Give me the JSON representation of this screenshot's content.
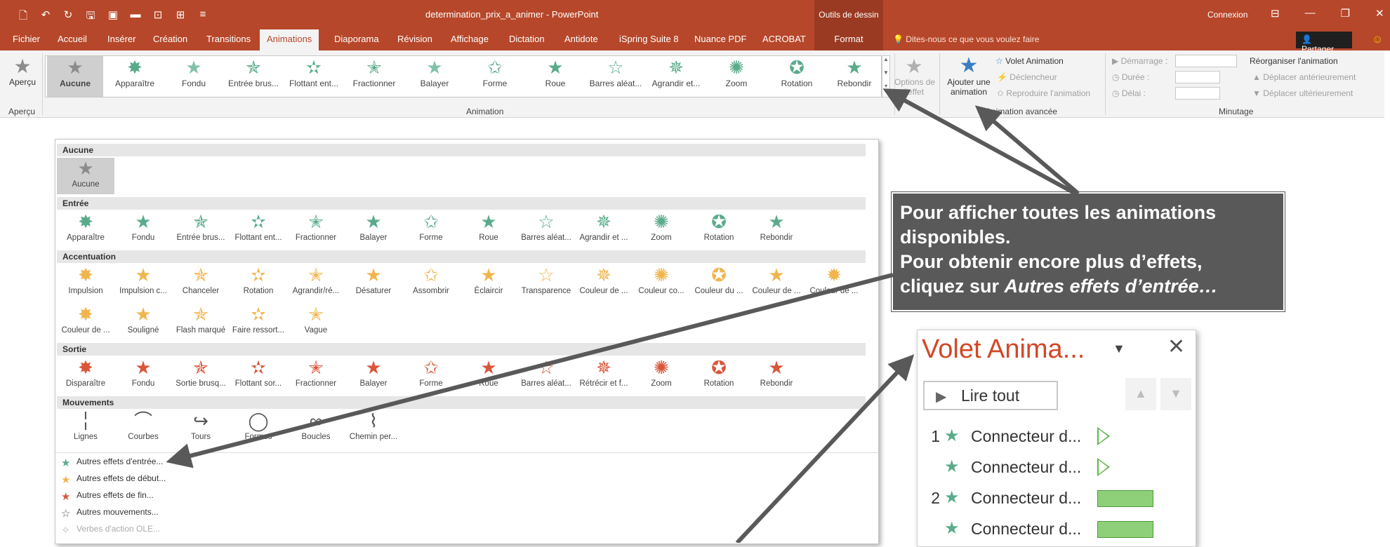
{
  "app": {
    "title": "determination_prix_a_animer  -  PowerPoint",
    "context_tab_group": "Outils de dessin",
    "connexion": "Connexion",
    "tell_me": "Dites-nous ce que vous voulez faire",
    "share": "Partager",
    "accent": "#b7472a"
  },
  "tabs": [
    "Fichier",
    "Accueil",
    "Insérer",
    "Création",
    "Transitions",
    "Animations",
    "Diaporama",
    "Révision",
    "Affichage",
    "Dictation",
    "Antidote",
    "iSpring Suite 8",
    "Nuance PDF",
    "ACROBAT",
    "Format"
  ],
  "active_tab": "Animations",
  "ribbon": {
    "apercu": "Aperçu",
    "apercu_group": "Aperçu",
    "animation_group": "Animation",
    "gallery": [
      "Aucune",
      "Apparaître",
      "Fondu",
      "Entrée brus...",
      "Flottant ent...",
      "Fractionner",
      "Balayer",
      "Forme",
      "Roue",
      "Barres aléat...",
      "Agrandir et...",
      "Zoom",
      "Rotation",
      "Rebondir"
    ],
    "options_effet_1": "Options de",
    "options_effet_2": "l'effet",
    "ajouter_1": "Ajouter une",
    "ajouter_2": "animation",
    "volet_animation": "Volet Animation",
    "declencheur": "Déclencheur",
    "reproduire": "Reproduire l'animation",
    "anim_avancee_group": "Animation avancée",
    "demarrage": "Démarrage :",
    "duree": "Durée :",
    "delai": "Délai :",
    "reorganiser": "Réorganiser l'animation",
    "deplacer_ant": "Déplacer antérieurement",
    "deplacer_ult": "Déplacer ultérieurement",
    "minutage_group": "Minutage"
  },
  "panel": {
    "aucune_header": "Aucune",
    "aucune_item": "Aucune",
    "entree_header": "Entrée",
    "entree": [
      "Apparaître",
      "Fondu",
      "Entrée brus...",
      "Flottant ent...",
      "Fractionner",
      "Balayer",
      "Forme",
      "Roue",
      "Barres aléat...",
      "Agrandir et ...",
      "Zoom",
      "Rotation",
      "Rebondir"
    ],
    "accent_header": "Accentuation",
    "accent": [
      "Impulsion",
      "Impulsion c...",
      "Chanceler",
      "Rotation",
      "Agrandir/ré...",
      "Désaturer",
      "Assombrir",
      "Éclaircir",
      "Transparence",
      "Couleur de ...",
      "Couleur co...",
      "Couleur du ...",
      "Couleur de ...",
      "Couleur de ..."
    ],
    "accent2": [
      "Couleur de ...",
      "Souligné",
      "Flash marqué",
      "Faire ressort...",
      "Vague"
    ],
    "sortie_header": "Sortie",
    "sortie": [
      "Disparaître",
      "Fondu",
      "Sortie brusq...",
      "Flottant sor...",
      "Fractionner",
      "Balayer",
      "Forme",
      "Roue",
      "Barres aléat...",
      "Rétrécir et f...",
      "Zoom",
      "Rotation",
      "Rebondir"
    ],
    "mouvements_header": "Mouvements",
    "mouvements": [
      "Lignes",
      "Courbes",
      "Tours",
      "Formes",
      "Boucles",
      "Chemin per..."
    ],
    "more": [
      "Autres effets d'entrée...",
      "Autres effets de début...",
      "Autres effets de fin...",
      "Autres mouvements...",
      "Verbes d'action OLE..."
    ]
  },
  "callout": {
    "line1": "Pour afficher toutes les animations",
    "line2": "disponibles.",
    "line3": "Pour obtenir encore plus d’effets,",
    "line4_a": "cliquez sur ",
    "line4_b": "Autres effets d’entrée…"
  },
  "volet": {
    "title": "Volet Anima...",
    "play_all": "Lire tout",
    "rows": [
      {
        "num": "1",
        "label": "Connecteur d...",
        "timing": "triangle"
      },
      {
        "num": "",
        "label": "Connecteur d...",
        "timing": "triangle"
      },
      {
        "num": "2",
        "label": "Connecteur d...",
        "timing": "bar"
      },
      {
        "num": "",
        "label": "Connecteur d...",
        "timing": "bar"
      }
    ]
  },
  "colors": {
    "entree": "#5aab8b",
    "accent": "#f0b54e",
    "sortie": "#d9563a",
    "gray": "#8c8c8c",
    "callout": "#595959",
    "volet_title": "#d24726"
  }
}
